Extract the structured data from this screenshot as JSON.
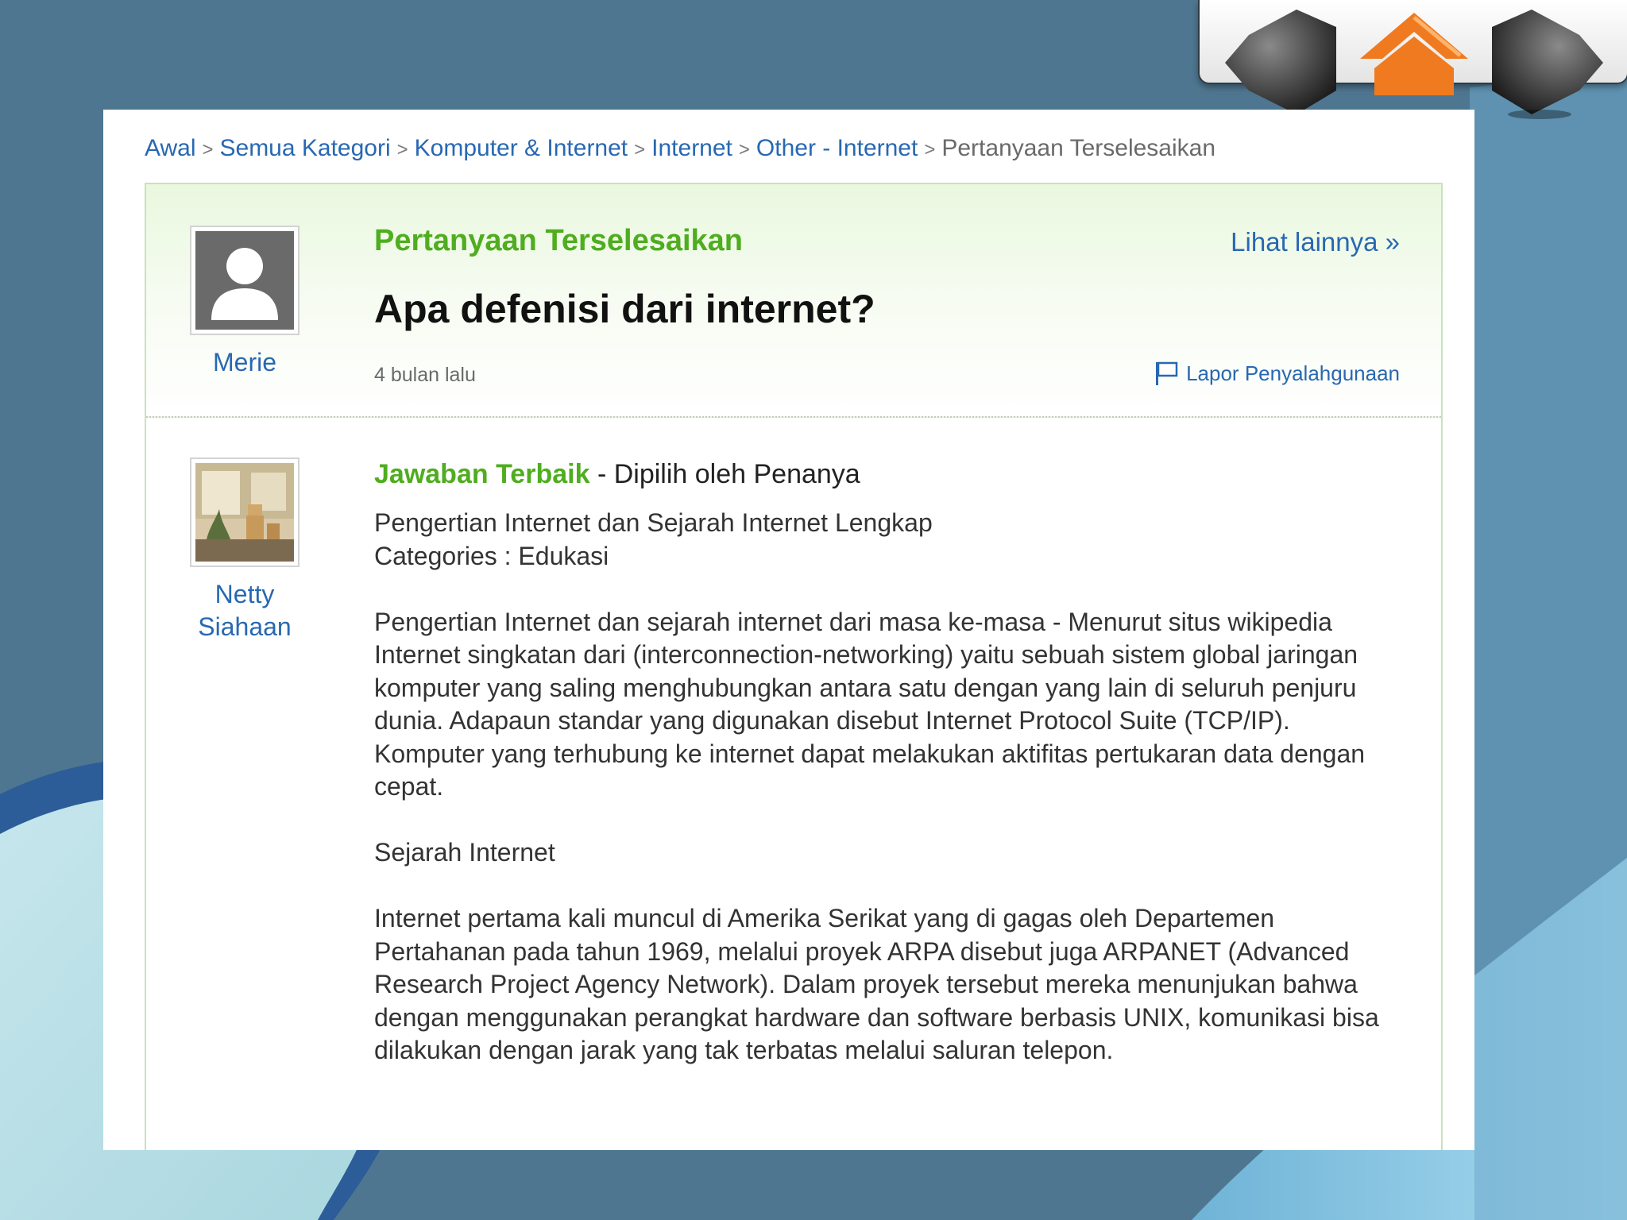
{
  "breadcrumb": {
    "items": [
      "Awal",
      "Semua Kategori",
      "Komputer & Internet",
      "Internet",
      "Other - Internet"
    ],
    "current": "Pertanyaan Terselesaikan",
    "separator": ">"
  },
  "question": {
    "status": "Pertanyaan Terselesaikan",
    "see_more": "Lihat lainnya »",
    "title": "Apa defenisi dari internet?",
    "asker": "Merie",
    "time": "4 bulan lalu",
    "report": "Lapor Penyalahgunaan"
  },
  "answer": {
    "best_label": "Jawaban Terbaik",
    "chosen_by": " - Dipilih oleh Penanya",
    "answerer_line1": "Netty",
    "answerer_line2": "Siahaan",
    "line1": "Pengertian Internet dan Sejarah Internet Lengkap",
    "line2": "Categories : Edukasi",
    "paragraph1": "Pengertian Internet dan sejarah internet dari masa ke-masa - Menurut situs wikipedia Internet singkatan dari (interconnection-networking) yaitu sebuah sistem global jaringan komputer yang saling menghubungkan antara satu dengan yang lain di seluruh penjuru dunia. Adapaun standar yang digunakan disebut Internet Protocol Suite (TCP/IP). Komputer yang terhubung ke internet dapat melakukan aktifitas pertukaran data dengan cepat.",
    "heading": "Sejarah Internet",
    "paragraph2": "Internet pertama kali muncul di Amerika Serikat yang di gagas oleh Departemen Pertahanan pada tahun 1969, melalui proyek ARPA disebut juga ARPANET (Advanced Research Project Agency Network). Dalam proyek tersebut mereka menunjukan bahwa dengan menggunakan perangkat hardware dan software berbasis UNIX, komunikasi bisa dilakukan dengan jarak yang tak terbatas melalui saluran telepon."
  },
  "colors": {
    "link": "#2868b2",
    "green": "#4fad1f",
    "slide_bg": "#4f7690",
    "nav_orange": "#f07a1f"
  }
}
